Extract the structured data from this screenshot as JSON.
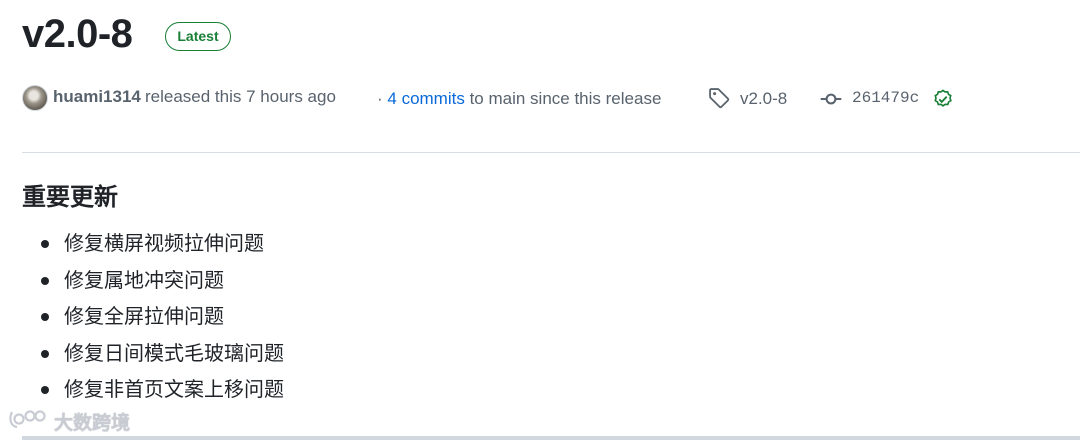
{
  "release": {
    "title": "v2.0-8",
    "badge": "Latest"
  },
  "meta": {
    "author": "huami1314",
    "released_text": "released this 7 hours ago",
    "commits_prefix": "· ",
    "commits_link": "4 commits",
    "commits_suffix": " to main since this release",
    "tag": "v2.0-8",
    "commit_sha": "261479c",
    "icons": [
      "tag-icon",
      "git-commit-icon",
      "verified-check-icon"
    ]
  },
  "notes": {
    "heading": "重要更新",
    "items": [
      "修复横屏视频拉伸问题",
      "修复属地冲突问题",
      "修复全屏拉伸问题",
      "修复日间模式毛玻璃问题",
      "修复非首页文案上移问题"
    ]
  },
  "watermark": {
    "text": "大数跨境"
  },
  "colors": {
    "badge_green": "#1a7f37",
    "link_blue": "#0969da",
    "muted_text": "#59636e"
  }
}
